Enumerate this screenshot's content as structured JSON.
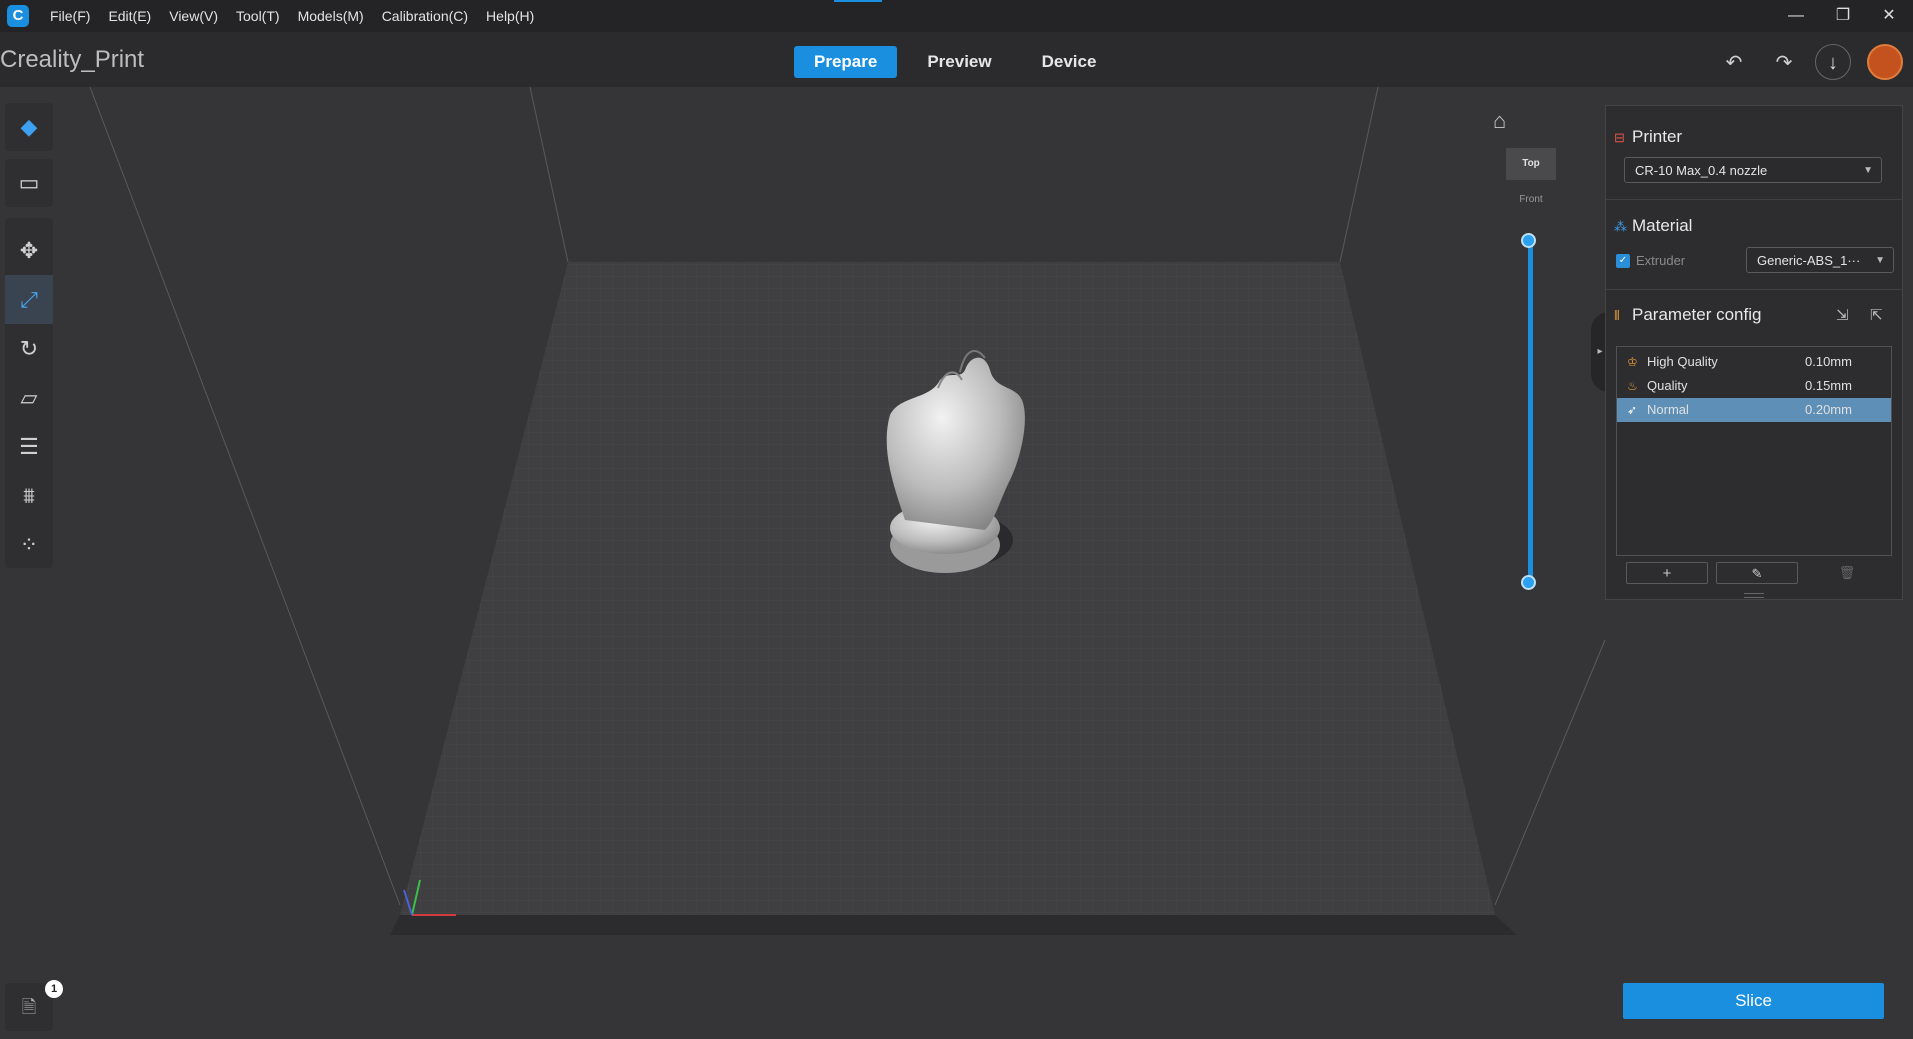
{
  "menu": [
    "File(F)",
    "Edit(E)",
    "View(V)",
    "Tool(T)",
    "Models(M)",
    "Calibration(C)",
    "Help(H)"
  ],
  "window_controls": {
    "minimize": "—",
    "maximize": "❐",
    "close": "✕"
  },
  "project_title": "Creality_Print",
  "tabs": [
    "Prepare",
    "Preview",
    "Device"
  ],
  "active_tab": "Prepare",
  "view_cube": {
    "top": "Top",
    "front": "Front"
  },
  "printer": {
    "title": "Printer",
    "selected": "CR-10 Max_0.4 nozzle"
  },
  "material": {
    "title": "Material",
    "extruder_label": "Extruder",
    "selected": "Generic-ABS_1···"
  },
  "parameter_config": {
    "title": "Parameter config",
    "rows": [
      {
        "name": "High Quality",
        "value": "0.10mm",
        "icon": "crown-icon"
      },
      {
        "name": "Quality",
        "value": "0.15mm",
        "icon": "flame-icon"
      },
      {
        "name": "Normal",
        "value": "0.20mm",
        "icon": "rocket-icon",
        "selected": true
      }
    ],
    "add": "+",
    "edit": "✎",
    "delete": "🗑"
  },
  "slice_label": "Slice",
  "notification_count": "1",
  "colors": {
    "accent": "#1a8fe0",
    "background": "#353537",
    "bed": "#3f3f41",
    "selected_row": "#5e8fb7"
  }
}
